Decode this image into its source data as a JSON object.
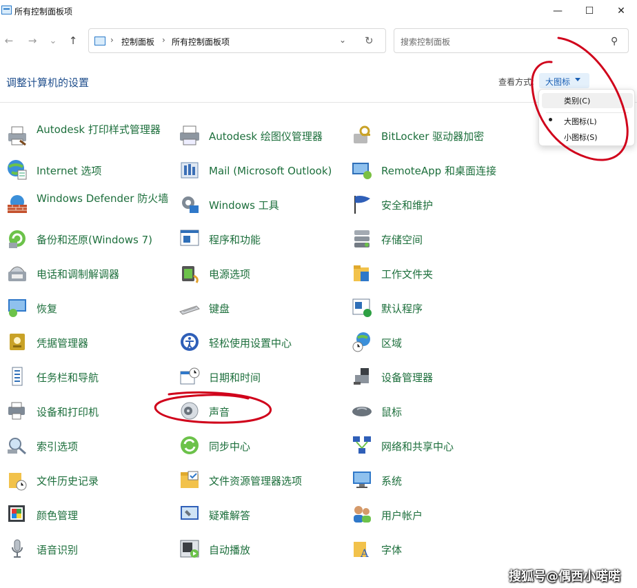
{
  "window": {
    "title": "所有控制面板项",
    "minimize_glyph": "—",
    "maximize_glyph": "☐",
    "close_glyph": "✕"
  },
  "toolbar": {
    "back_glyph": "←",
    "forward_glyph": "→",
    "recent_glyph": "⌄",
    "up_glyph": "↑",
    "breadcrumb": [
      "控制面板",
      "所有控制面板项"
    ],
    "crumb_separator": "›",
    "dropdown_glyph": "⌄",
    "refresh_glyph": "↻",
    "search_placeholder": "搜索控制面板",
    "search_glyph": "⚲"
  },
  "header": {
    "title": "调整计算机的设置",
    "view_label": "查看方式:",
    "view_value": "大图标"
  },
  "view_menu": {
    "items": [
      "类别(C)",
      "大图标(L)",
      "小图标(S)"
    ],
    "selected": "大图标(L)"
  },
  "items": [
    {
      "label": "Autodesk 打印样式管理器",
      "icon": "printer-style-icon"
    },
    {
      "label": "Autodesk 绘图仪管理器",
      "icon": "plotter-icon"
    },
    {
      "label": "BitLocker 驱动器加密",
      "icon": "bitlocker-icon"
    },
    {
      "label": "Internet 选项",
      "icon": "internet-options-icon"
    },
    {
      "label": "Mail (Microsoft Outlook)",
      "icon": "mail-icon"
    },
    {
      "label": "RemoteApp 和桌面连接",
      "icon": "remoteapp-icon"
    },
    {
      "label": "Windows Defender 防火墙",
      "icon": "firewall-icon"
    },
    {
      "label": "Windows 工具",
      "icon": "windows-tools-icon"
    },
    {
      "label": "安全和维护",
      "icon": "security-flag-icon"
    },
    {
      "label": "备份和还原(Windows 7)",
      "icon": "backup-icon"
    },
    {
      "label": "程序和功能",
      "icon": "programs-icon"
    },
    {
      "label": "存储空间",
      "icon": "storage-icon"
    },
    {
      "label": "电话和调制解调器",
      "icon": "phone-modem-icon"
    },
    {
      "label": "电源选项",
      "icon": "power-icon"
    },
    {
      "label": "工作文件夹",
      "icon": "work-folders-icon"
    },
    {
      "label": "恢复",
      "icon": "recovery-icon"
    },
    {
      "label": "键盘",
      "icon": "keyboard-icon"
    },
    {
      "label": "默认程序",
      "icon": "default-programs-icon"
    },
    {
      "label": "凭据管理器",
      "icon": "credential-icon"
    },
    {
      "label": "轻松使用设置中心",
      "icon": "ease-of-access-icon"
    },
    {
      "label": "区域",
      "icon": "region-icon"
    },
    {
      "label": "任务栏和导航",
      "icon": "taskbar-icon"
    },
    {
      "label": "日期和时间",
      "icon": "calendar-clock-icon"
    },
    {
      "label": "设备管理器",
      "icon": "device-manager-icon"
    },
    {
      "label": "设备和打印机",
      "icon": "devices-printers-icon"
    },
    {
      "label": "声音",
      "icon": "speaker-icon"
    },
    {
      "label": "鼠标",
      "icon": "mouse-icon"
    },
    {
      "label": "索引选项",
      "icon": "indexing-icon"
    },
    {
      "label": "同步中心",
      "icon": "sync-icon"
    },
    {
      "label": "网络和共享中心",
      "icon": "network-icon"
    },
    {
      "label": "文件历史记录",
      "icon": "file-history-icon"
    },
    {
      "label": "文件资源管理器选项",
      "icon": "folder-options-icon"
    },
    {
      "label": "系统",
      "icon": "system-monitor-icon"
    },
    {
      "label": "颜色管理",
      "icon": "color-management-icon"
    },
    {
      "label": "疑难解答",
      "icon": "troubleshoot-icon"
    },
    {
      "label": "用户帐户",
      "icon": "user-accounts-icon"
    },
    {
      "label": "语音识别",
      "icon": "microphone-icon"
    },
    {
      "label": "自动播放",
      "icon": "autoplay-icon"
    },
    {
      "label": "字体",
      "icon": "fonts-icon"
    }
  ],
  "watermark": "搜狐号@偶西小喏喏",
  "colors": {
    "item_text": "#1d6f3c",
    "heading": "#1f4e8c",
    "annotation": "#d0021b"
  }
}
